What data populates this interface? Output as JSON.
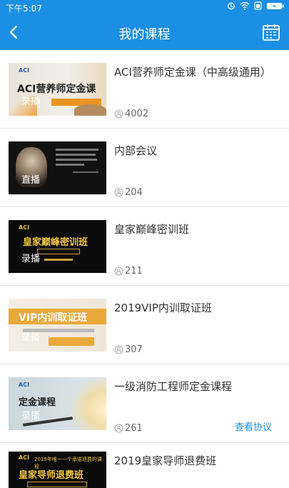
{
  "status": {
    "time": "下午5:07"
  },
  "header": {
    "title": "我的课程"
  },
  "courses": [
    {
      "title": "ACI营养师定金课（中高级通用）",
      "count": "4002",
      "thumb_tag": "录播",
      "thumb_logo": "ACI",
      "thumb_big": "ACI营养师定金课"
    },
    {
      "title": "内部会议",
      "count": "204",
      "thumb_tag": "直播"
    },
    {
      "title": "皇家巅峰密训班",
      "count": "211",
      "thumb_tag": "录播",
      "thumb_logo": "ACI",
      "thumb_big": "皇家巅峰密训班"
    },
    {
      "title": "2019VIP内训取证班",
      "count": "307",
      "thumb_tag": "录播",
      "thumb_big": "VIP内训取证班"
    },
    {
      "title": "一级消防工程师定金课程",
      "count": "261",
      "thumb_tag": "录播",
      "thumb_logo": "ACI",
      "thumb_big": "定金课程",
      "link": "查看协议"
    },
    {
      "title": "2019皇家导师退费班",
      "thumb_logo": "ACI",
      "thumb_big": "皇家导师退费班",
      "thumb_sub": "2019年唯一一个承诺退费的课程"
    }
  ]
}
